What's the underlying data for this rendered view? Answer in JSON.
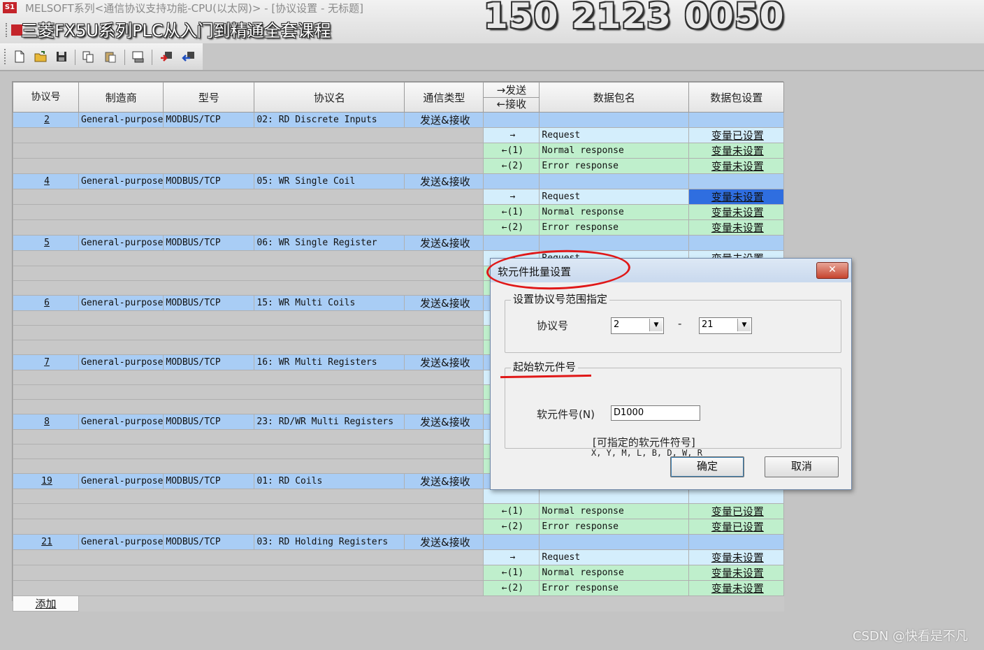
{
  "window": {
    "title": "MELSOFT系列<通信协议支持功能-CPU(以太网)> - [协议设置 - 无标题]",
    "overlay_title": "三菱FX5U系列PLC从入门到精通全套课程",
    "overlay_phone": "150 2123 0050"
  },
  "toolbar": {
    "buttons": [
      "new-file-icon",
      "open-folder-icon",
      "save-icon",
      "copy-icon",
      "paste-icon",
      "print-preview-icon",
      "write-plc-icon",
      "read-plc-icon"
    ]
  },
  "table": {
    "headers": {
      "proto_no": "协议号",
      "maker": "制造商",
      "model": "型号",
      "proto_name": "协议名",
      "comm_type": "通信类型",
      "send": "→发送",
      "recv": "←接收",
      "packet_name": "数据包名",
      "packet_setting": "数据包设置"
    },
    "protocols": [
      {
        "no": "2",
        "maker": "General-purpose",
        "model": "MODBUS/TCP",
        "name": "02: RD Discrete Inputs",
        "type": "发送&接收",
        "packets": [
          {
            "dir": "→",
            "name": "Request",
            "setting": "变量已设置",
            "state": "set"
          },
          {
            "dir": "←(1)",
            "name": "Normal response",
            "setting": "变量未设置",
            "state": "unset"
          },
          {
            "dir": "←(2)",
            "name": "Error response",
            "setting": "变量未设置",
            "state": "unset"
          }
        ]
      },
      {
        "no": "4",
        "maker": "General-purpose",
        "model": "MODBUS/TCP",
        "name": "05: WR Single Coil",
        "type": "发送&接收",
        "packets": [
          {
            "dir": "→",
            "name": "Request",
            "setting": "变量未设置",
            "state": "sel"
          },
          {
            "dir": "←(1)",
            "name": "Normal response",
            "setting": "变量未设置",
            "state": "unset"
          },
          {
            "dir": "←(2)",
            "name": "Error response",
            "setting": "变量未设置",
            "state": "unset"
          }
        ]
      },
      {
        "no": "5",
        "maker": "General-purpose",
        "model": "MODBUS/TCP",
        "name": "06: WR Single Register",
        "type": "发送&接收",
        "packets": [
          {
            "dir": "→",
            "name": "Request",
            "setting": "变量未设置",
            "state": "unset"
          },
          {
            "dir": "",
            "name": "",
            "setting": "",
            "state": "unset"
          },
          {
            "dir": "",
            "name": "",
            "setting": "",
            "state": "unset"
          }
        ]
      },
      {
        "no": "6",
        "maker": "General-purpose",
        "model": "MODBUS/TCP",
        "name": "15: WR Multi Coils",
        "type": "发送&接收",
        "packets": [
          {
            "dir": "",
            "name": "",
            "setting": "",
            "state": "unset"
          },
          {
            "dir": "",
            "name": "",
            "setting": "",
            "state": "unset"
          },
          {
            "dir": "",
            "name": "",
            "setting": "",
            "state": "unset"
          }
        ]
      },
      {
        "no": "7",
        "maker": "General-purpose",
        "model": "MODBUS/TCP",
        "name": "16: WR Multi Registers",
        "type": "发送&接收",
        "packets": [
          {
            "dir": "",
            "name": "",
            "setting": "",
            "state": "unset"
          },
          {
            "dir": "",
            "name": "",
            "setting": "",
            "state": "unset"
          },
          {
            "dir": "",
            "name": "",
            "setting": "",
            "state": "unset"
          }
        ]
      },
      {
        "no": "8",
        "maker": "General-purpose",
        "model": "MODBUS/TCP",
        "name": "23: RD/WR Multi Registers",
        "type": "发送&接收",
        "packets": [
          {
            "dir": "",
            "name": "",
            "setting": "",
            "state": "unset"
          },
          {
            "dir": "",
            "name": "",
            "setting": "",
            "state": "unset"
          },
          {
            "dir": "",
            "name": "",
            "setting": "",
            "state": "unset"
          }
        ]
      },
      {
        "no": "19",
        "maker": "General-purpose",
        "model": "MODBUS/TCP",
        "name": "01: RD Coils",
        "type": "发送&接收",
        "packets": [
          {
            "dir": "",
            "name": "",
            "setting": "",
            "state": "set"
          },
          {
            "dir": "←(1)",
            "name": "Normal response",
            "setting": "变量已设置",
            "state": "set"
          },
          {
            "dir": "←(2)",
            "name": "Error response",
            "setting": "变量已设置",
            "state": "set"
          }
        ]
      },
      {
        "no": "21",
        "maker": "General-purpose",
        "model": "MODBUS/TCP",
        "name": "03: RD Holding Registers",
        "type": "发送&接收",
        "packets": [
          {
            "dir": "→",
            "name": "Request",
            "setting": "变量未设置",
            "state": "unset"
          },
          {
            "dir": "←(1)",
            "name": "Normal response",
            "setting": "变量未设置",
            "state": "unset"
          },
          {
            "dir": "←(2)",
            "name": "Error response",
            "setting": "变量未设置",
            "state": "unset"
          }
        ]
      }
    ],
    "add_label": "添加"
  },
  "dialog": {
    "title": "软元件批量设置",
    "close_label": "✕",
    "range_group": "设置协议号范围指定",
    "proto_label": "协议号",
    "range_from": "2",
    "range_sep": "-",
    "range_to": "21",
    "start_group": "起始软元件号",
    "device_label": "软元件号(N)",
    "device_value": "D1000",
    "hint_line1": "[可指定的软元件符号]",
    "hint_line2": "X, Y, M, L, B, D, W, R",
    "ok_label": "确定",
    "cancel_label": "取消"
  },
  "watermark": "CSDN @快看是不凡",
  "colors": {
    "protocol_row": "#a9cdf5",
    "packet_row": "#bfefcc",
    "set_text": "#1a2fd0",
    "unset_text": "#e01010",
    "selected_cell": "#2f6ee0",
    "annotation": "#e01818"
  }
}
